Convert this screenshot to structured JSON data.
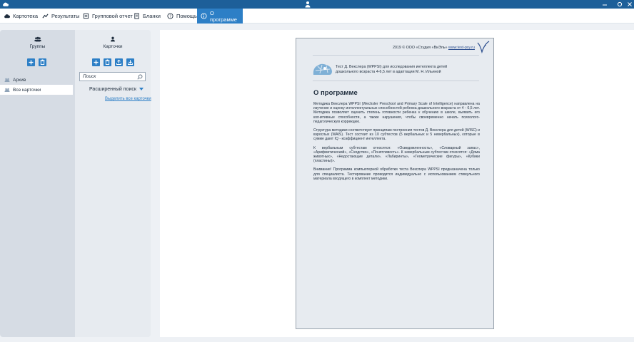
{
  "titlebar": {
    "app_icon": "cloud-icon",
    "user_icon": "user-icon",
    "controls": [
      "minimize-icon",
      "maximize-icon",
      "close-icon"
    ]
  },
  "menu": {
    "items": [
      {
        "label": "Картотека",
        "icon": "cloud-icon"
      },
      {
        "label": "Результаты",
        "icon": "chart-line-icon"
      },
      {
        "label": "Групповой отчет",
        "icon": "report-icon"
      },
      {
        "label": "Бланки",
        "icon": "blank-form-icon"
      },
      {
        "label": "Помощь",
        "icon": "help-icon"
      },
      {
        "label": "О программе",
        "icon": "info-icon",
        "active": true
      }
    ]
  },
  "groups_panel": {
    "title": "Группы",
    "items": [
      {
        "label": "Архив",
        "selected": false
      },
      {
        "label": "Все карточки",
        "selected": true
      }
    ]
  },
  "cards_panel": {
    "title": "Карточки",
    "search_placeholder": "Поиск",
    "advanced_search": "Расширенный поиск",
    "select_all": "Выделить все карточки"
  },
  "document": {
    "copyright": "2019 © ООО «Студия «ВиЭль»",
    "site": "www.test-psy.ru",
    "subtitle_line1": "Тест Д. Векслера (WPPSI) для исследования интеллекта детей",
    "subtitle_line2": "дошкольного возраста 4-6,5 лет в адаптации М. Н. Ильиной",
    "heading": "О программе",
    "paragraphs": [
      "Методика Векслера WPPSI (Wechsler Preschool and Primary Scale of Intelligence) направлена на изучение и оценку интеллектуальных способностей ребенка дошкольного возраста от 4 - 6,5 лет. Методика позволяет оценить степень готовности ребенка к обучению в школе, выявить его когнитивные способности, а также нарушения, чтобы своевременно начать психолого-педагогическую коррекцию.",
      "Структура методики соответствует принципам построения тестов Д. Векслера для детей (WISC) и взрослых (WAIS). Тест состоит из 10 субтестов (5 вербальных и 5 невербальных), которые в сумме дают IQ - коэффициент интеллекта.",
      "К вербальным субтестам относятся: «Осведомленность», «Словарный запас», «Арифметический», «Сходство», «Понятливость». К невербальным субтестам относятся: «Дома животных», «Недостающие детали», «Лабиринты», «Геометрические фигуры», «Кубики (пластины)».",
      "Внимание! Программа компьютерной обработки теста Векслера WPPSI предназначена только для специалиста. Тестирование проводится индивидуально с использованием стимульного материала входящего в комплект методики."
    ]
  },
  "colors": {
    "titlebar": "#1d5f99",
    "accent": "#2d7fc6",
    "panel": "#e7ebf0",
    "panel_dark": "#d6dce4"
  }
}
